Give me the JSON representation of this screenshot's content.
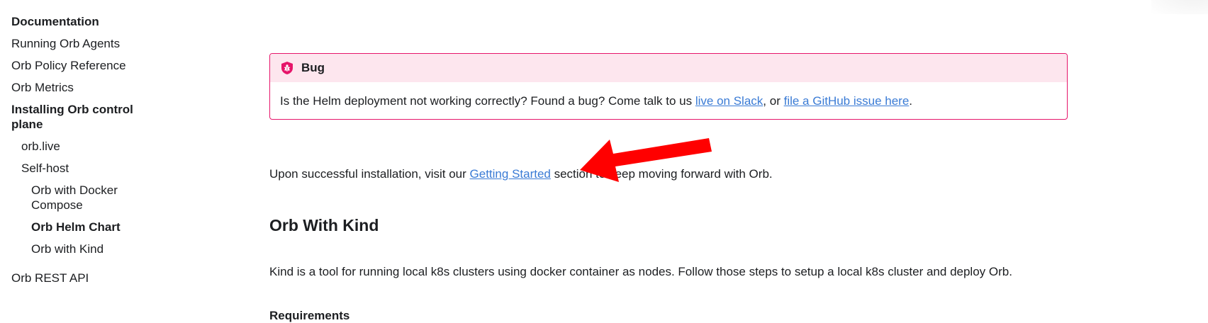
{
  "sidebar": {
    "items": [
      {
        "label": "Documentation"
      },
      {
        "label": "Running Orb Agents"
      },
      {
        "label": "Orb Policy Reference"
      },
      {
        "label": "Orb Metrics"
      },
      {
        "label": "Installing Orb control plane"
      },
      {
        "label": "orb.live"
      },
      {
        "label": "Self-host"
      },
      {
        "label": "Orb with Docker Compose"
      },
      {
        "label": "Orb Helm Chart"
      },
      {
        "label": "Orb with Kind"
      },
      {
        "label": "Orb REST API"
      }
    ]
  },
  "admonition": {
    "title": "Bug",
    "text_before": "Is the Helm deployment not working correctly? Found a bug? Come talk to us ",
    "link1": "live on Slack",
    "text_mid": ", or ",
    "link2": "file a GitHub issue here",
    "text_after": ".",
    "icon": "bug-shield-icon",
    "border_color": "#e6156a",
    "header_bg": "#fde6ee"
  },
  "content": {
    "para1_before": "Upon successful installation, visit our ",
    "para1_link": "Getting Started",
    "para1_after": " section to keep moving forward with Orb.",
    "heading": "Orb With Kind",
    "para2": "Kind is a tool for running local k8s clusters using docker container as nodes. Follow those steps to setup a local k8s cluster and deploy Orb.",
    "subheading": "Requirements"
  },
  "annotation": {
    "icon": "red-arrow-icon",
    "color": "#ff0000"
  }
}
